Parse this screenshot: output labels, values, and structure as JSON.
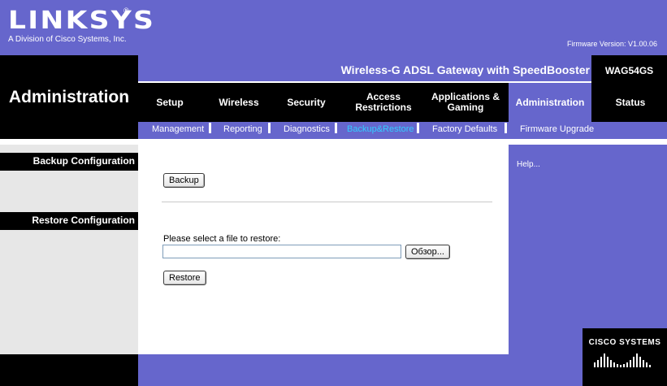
{
  "header": {
    "logo": "LINKSYS",
    "logo_reg": "®",
    "logo_subtitle": "A Division of Cisco Systems, Inc.",
    "firmware": "Firmware Version: V1.00.06"
  },
  "product": {
    "name": "Wireless-G ADSL Gateway with SpeedBooster",
    "model": "WAG54GS"
  },
  "section_title": "Administration",
  "tabs": [
    {
      "label": "Setup"
    },
    {
      "label": "Wireless"
    },
    {
      "label": "Security"
    },
    {
      "label": "Access\nRestrictions"
    },
    {
      "label": "Applications &\nGaming"
    },
    {
      "label": "Administration",
      "active": true
    },
    {
      "label": "Status"
    }
  ],
  "subtabs": [
    {
      "label": "Management"
    },
    {
      "label": "Reporting"
    },
    {
      "label": "Diagnostics"
    },
    {
      "label": "Backup&Restore",
      "active": true
    },
    {
      "label": "Factory Defaults"
    },
    {
      "label": "Firmware Upgrade"
    }
  ],
  "side": {
    "backup_heading": "Backup Configuration",
    "restore_heading": "Restore Configuration"
  },
  "main": {
    "backup_button": "Backup",
    "file_label": "Please select a file to restore:",
    "file_value": "",
    "browse_button": "Обзор...",
    "restore_button": "Restore"
  },
  "help": {
    "link": "Help..."
  },
  "cisco": {
    "name": "CISCO SYSTEMS"
  },
  "colors": {
    "brand_purple": "#6666cc",
    "active_subtab": "#33ccff",
    "black": "#000000"
  }
}
